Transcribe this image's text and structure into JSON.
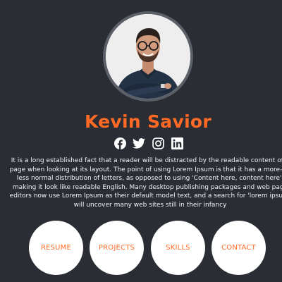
{
  "profile": {
    "name": "Kevin Savior",
    "avatar_alt": "profile photo"
  },
  "socials": [
    {
      "icon": "facebook-icon"
    },
    {
      "icon": "twitter-icon"
    },
    {
      "icon": "instagram-icon"
    },
    {
      "icon": "linkedin-icon"
    }
  ],
  "bio": {
    "text": "It is a long established fact that a reader will be distracted by the readable content of a page when looking at its layout. The point of using Lorem Ipsum is that it has a more-or-less normal distribution of letters, as opposed to using 'Content here, content here', making it look like readable English. Many desktop publishing packages and web page editors now use Lorem Ipsum as their default model text, and a search for 'lorem ipsum' will uncover many web sites still in their infancy"
  },
  "nav": {
    "items": [
      {
        "label": "RESUME"
      },
      {
        "label": "PROJECTS"
      },
      {
        "label": "SKILLS"
      },
      {
        "label": "CONTACT"
      }
    ]
  },
  "colors": {
    "background": "#2a2d33",
    "accent": "#ff6a26",
    "nav_bg": "#ffffff",
    "text": "#f2f2f2"
  }
}
